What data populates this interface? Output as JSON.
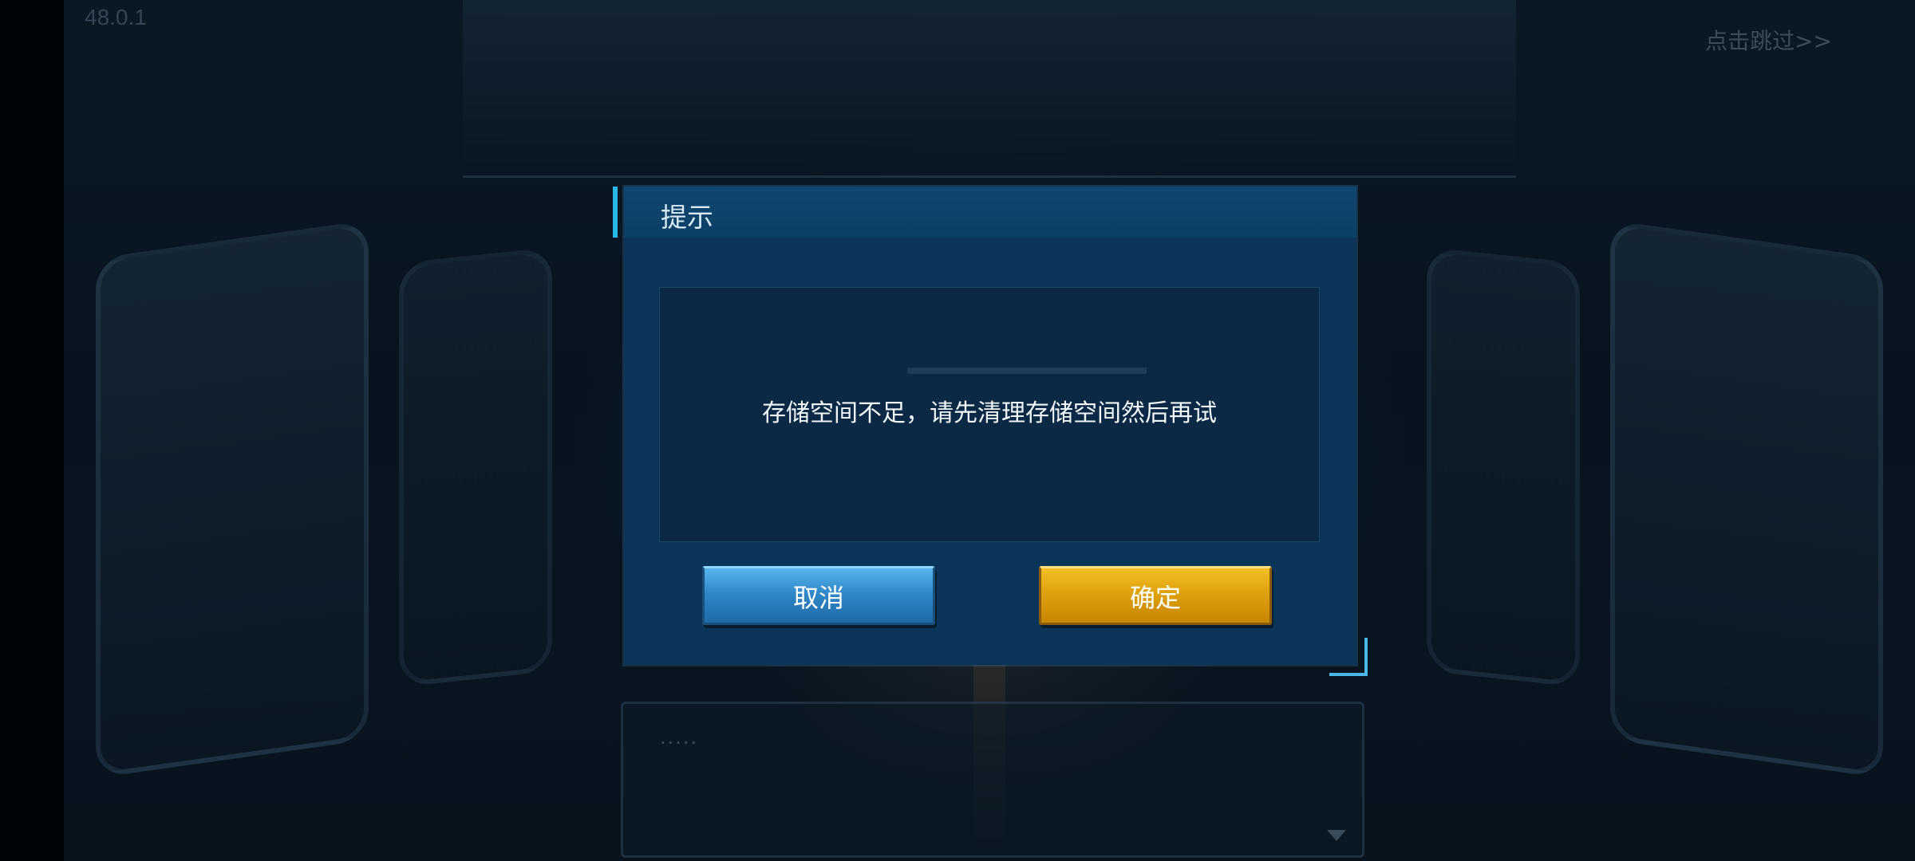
{
  "app": {
    "version_label": "48.0.1",
    "skip_label": "点击跳过>>"
  },
  "dialog": {
    "title": "提示",
    "message": "存储空间不足，请先清理存储空间然后再试",
    "cancel_label": "取消",
    "confirm_label": "确定"
  },
  "background_panel": {
    "placeholder_text": "....."
  },
  "colors": {
    "dialog_bg": "#0b3558",
    "accent": "#27b8e8",
    "cancel_button": "#2f86c6",
    "confirm_button": "#dc9f0c"
  }
}
